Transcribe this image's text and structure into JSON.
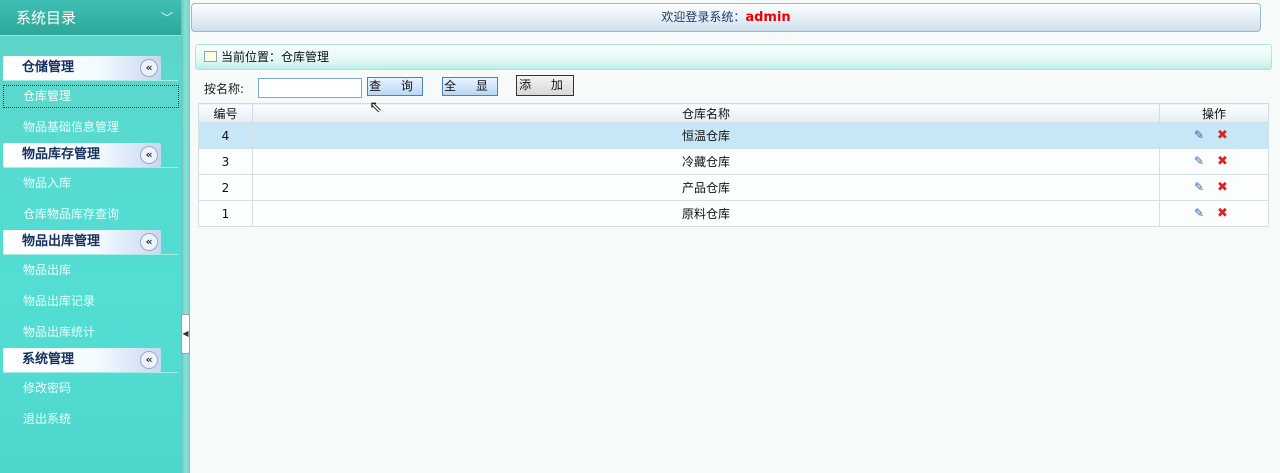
{
  "sidebar": {
    "title": "系统目录",
    "collapse_icon": "chevron-down-icon",
    "groups": [
      {
        "title": "仓储管理",
        "items": [
          {
            "label": "仓库管理",
            "active": true
          },
          {
            "label": "物品基础信息管理"
          }
        ]
      },
      {
        "title": "物品库存管理",
        "items": [
          {
            "label": "物品入库"
          },
          {
            "label": "仓库物品库存查询"
          }
        ]
      },
      {
        "title": "物品出库管理",
        "items": [
          {
            "label": "物品出库"
          },
          {
            "label": "物品出库记录"
          },
          {
            "label": "物品出库统计"
          }
        ]
      },
      {
        "title": "系统管理",
        "items": [
          {
            "label": "修改密码"
          },
          {
            "label": "退出系统"
          }
        ]
      }
    ]
  },
  "topbar": {
    "welcome": "欢迎登录系统：",
    "user": "admin"
  },
  "breadcrumb": {
    "text": "当前位置：仓库管理"
  },
  "search": {
    "label": "按名称:",
    "input_value": "",
    "query_button": "查 询",
    "show_all_button": "全 显",
    "add_button": "添 加"
  },
  "table": {
    "columns": [
      "编号",
      "仓库名称",
      "操作"
    ],
    "rows": [
      {
        "id": "4",
        "name": "恒温仓库",
        "selected": true
      },
      {
        "id": "3",
        "name": "冷藏仓库"
      },
      {
        "id": "2",
        "name": "产品仓库"
      },
      {
        "id": "1",
        "name": "原料仓库"
      }
    ]
  },
  "colors": {
    "sidebar": "#55dcd2",
    "group_title_text": "#17305e",
    "admin": "#ee0000",
    "selected_row": "#c7e6f6"
  }
}
